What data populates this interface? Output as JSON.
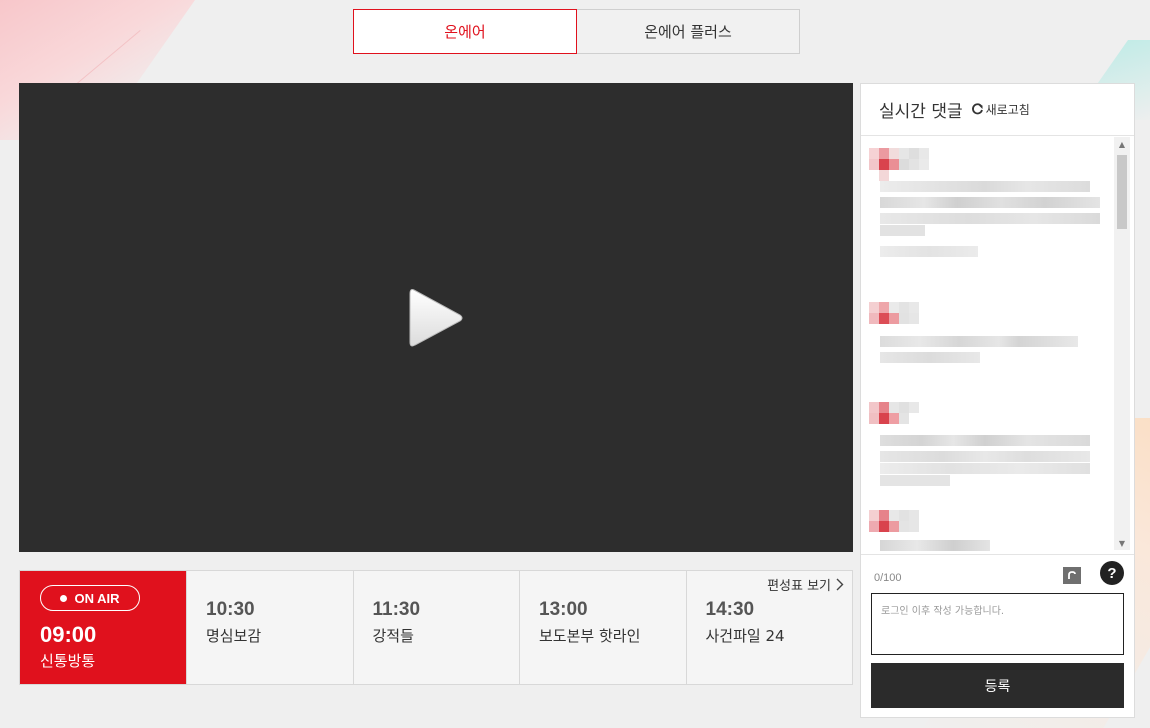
{
  "tabs": [
    {
      "label": "온에어",
      "active": true
    },
    {
      "label": "온에어 플러스",
      "active": false
    }
  ],
  "player": {
    "play_icon": "play-icon"
  },
  "schedule": {
    "link_label": "편성표 보기",
    "on_air": {
      "badge": "ON AIR",
      "time": "09:00",
      "title": "신통방통"
    },
    "items": [
      {
        "time": "10:30",
        "title": "명심보감"
      },
      {
        "time": "11:30",
        "title": "강적들"
      },
      {
        "time": "13:00",
        "title": "보도본부 핫라인"
      },
      {
        "time": "14:30",
        "title": "사건파일 24"
      }
    ]
  },
  "comments": {
    "title": "실시간 댓글",
    "refresh_label": "새로고침",
    "count": "0/100",
    "placeholder": "로그인 이후 작성 가능합니다.",
    "submit_label": "등록"
  },
  "colors": {
    "accent": "#e0111d",
    "player_bg": "#2d2d2d",
    "submit_bg": "#2b2b2b"
  }
}
